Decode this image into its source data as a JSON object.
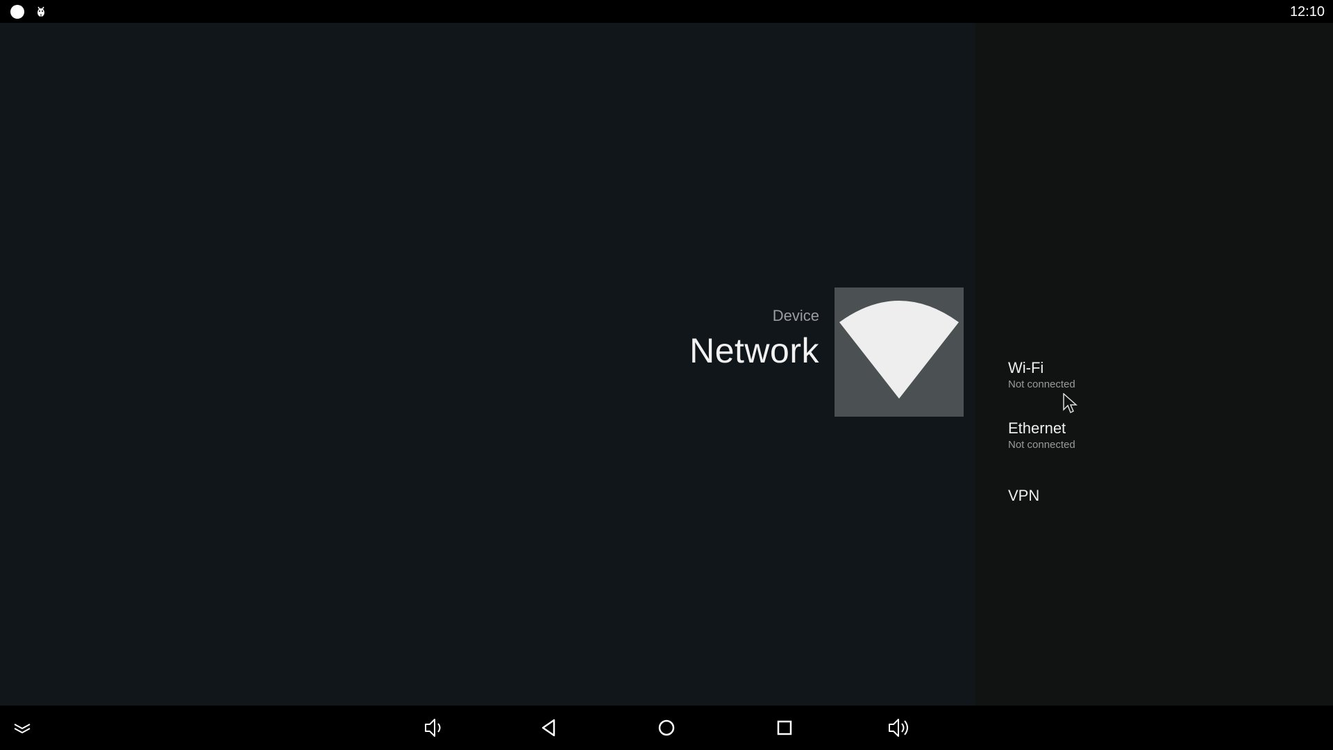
{
  "status_bar": {
    "time": "12:10",
    "icons": [
      "circle-notification-icon",
      "android-debug-icon"
    ]
  },
  "header": {
    "breadcrumb": "Device",
    "title": "Network",
    "icon": "wifi-icon"
  },
  "menu": {
    "items": [
      {
        "title": "Wi-Fi",
        "subtitle": "Not connected"
      },
      {
        "title": "Ethernet",
        "subtitle": "Not connected"
      },
      {
        "title": "VPN",
        "subtitle": ""
      }
    ]
  },
  "nav_bar": {
    "buttons": [
      "collapse-icon",
      "volume-down-icon",
      "back-icon",
      "home-icon",
      "recents-icon",
      "volume-up-icon"
    ]
  },
  "colors": {
    "background_left": "#11161a",
    "background_right": "#111313",
    "icon_tile": "#4b5053",
    "text_primary": "#eeeeee",
    "text_secondary": "#9a9a9a"
  }
}
